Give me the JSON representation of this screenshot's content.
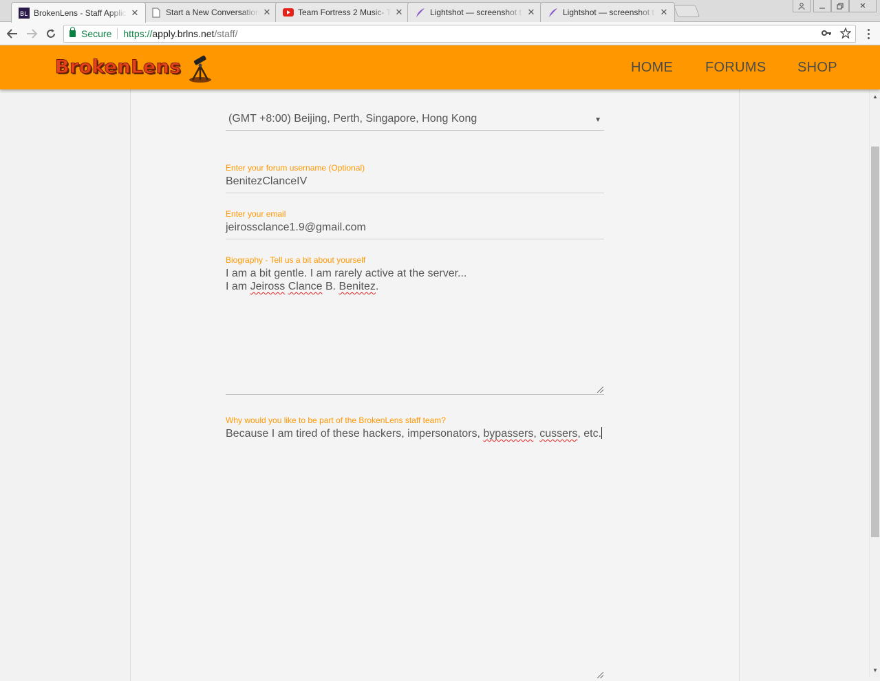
{
  "browser": {
    "tabs": [
      {
        "title": "BrokenLens - Staff Applic",
        "favicon": "brokenlens-favicon",
        "active": true
      },
      {
        "title": "Start a New Conversation",
        "favicon": "page-icon",
        "active": false
      },
      {
        "title": "Team Fortress 2 Music- T",
        "favicon": "youtube-icon",
        "active": false
      },
      {
        "title": "Lightshot — screenshot t",
        "favicon": "feather-icon",
        "active": false
      },
      {
        "title": "Lightshot — screenshot t",
        "favicon": "feather-icon",
        "active": false
      }
    ],
    "address": {
      "secure_label": "Secure",
      "scheme": "https://",
      "host": "apply.brlns.net",
      "path": "/staff/"
    }
  },
  "site": {
    "logo_text": "BrokenLens",
    "nav": [
      "HOME",
      "FORUMS",
      "SHOP"
    ],
    "brand_color": "#ff9800"
  },
  "form": {
    "timezone": {
      "selected": "(GMT +8:00) Beijing, Perth, Singapore, Hong Kong"
    },
    "username": {
      "label": "Enter your forum username (Optional)",
      "value": "BenitezClanceIV"
    },
    "email": {
      "label": "Enter your email",
      "value": "jeirossclance1.9@gmail.com"
    },
    "biography": {
      "label": "Biography - Tell us a bit about yourself",
      "line1": "I am a bit gentle. I am rarely active at the server...",
      "line2_a": "I am ",
      "line2_w1": "Jeiross",
      "line2_sp1": " ",
      "line2_w2": "Clance",
      "line2_b": " B. ",
      "line2_w3": "Benitez",
      "line2_c": "."
    },
    "reason": {
      "label": "Why would you like to be part of the BrokenLens staff team?",
      "text_a": "Because I am tired of these hackers, impersonators, ",
      "text_w1": "bypassers",
      "text_b": ", ",
      "text_w2": "cussers",
      "text_c": ", etc."
    }
  }
}
